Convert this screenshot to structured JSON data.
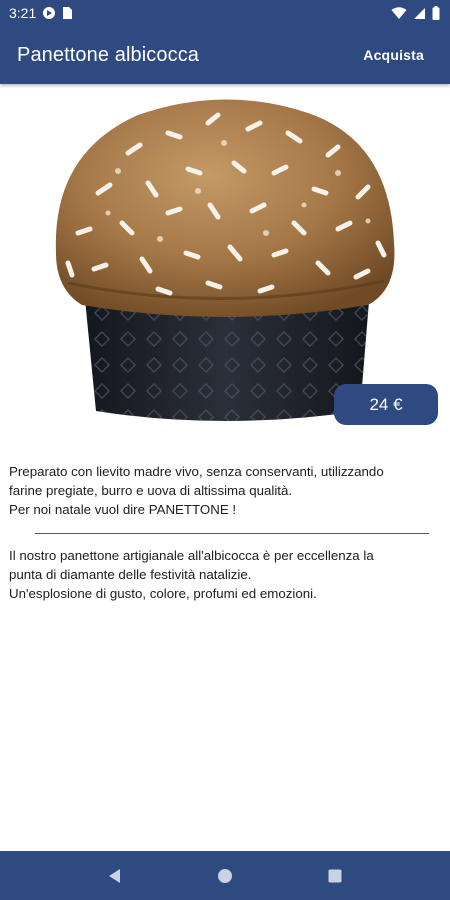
{
  "status_bar": {
    "time": "3:21",
    "icons": [
      "media-icon",
      "sim-card-icon",
      "wifi-icon",
      "signal-icon",
      "battery-icon"
    ]
  },
  "app_bar": {
    "title": "Panettone albicocca",
    "action_label": "Acquista"
  },
  "product": {
    "image": "panettone-image",
    "price": "24 €",
    "intro_text": "Preparato con lievito madre vivo, senza conservanti, utilizzando\nfarine pregiate, burro e uova di altissima qualità.\nPer noi natale vuol dire PANETTONE !",
    "detail_text": "Il nostro panettone artigianale all'albicocca è per eccellenza la\npunta di diamante delle festività natalizie.\nUn'esplosione di gusto, colore, profumi ed emozioni."
  },
  "nav_bar": {
    "buttons": [
      "back-icon",
      "home-icon",
      "recents-icon"
    ]
  },
  "colors": {
    "primary": "#2f4a80",
    "background": "#ffffff",
    "text": "#202020"
  }
}
